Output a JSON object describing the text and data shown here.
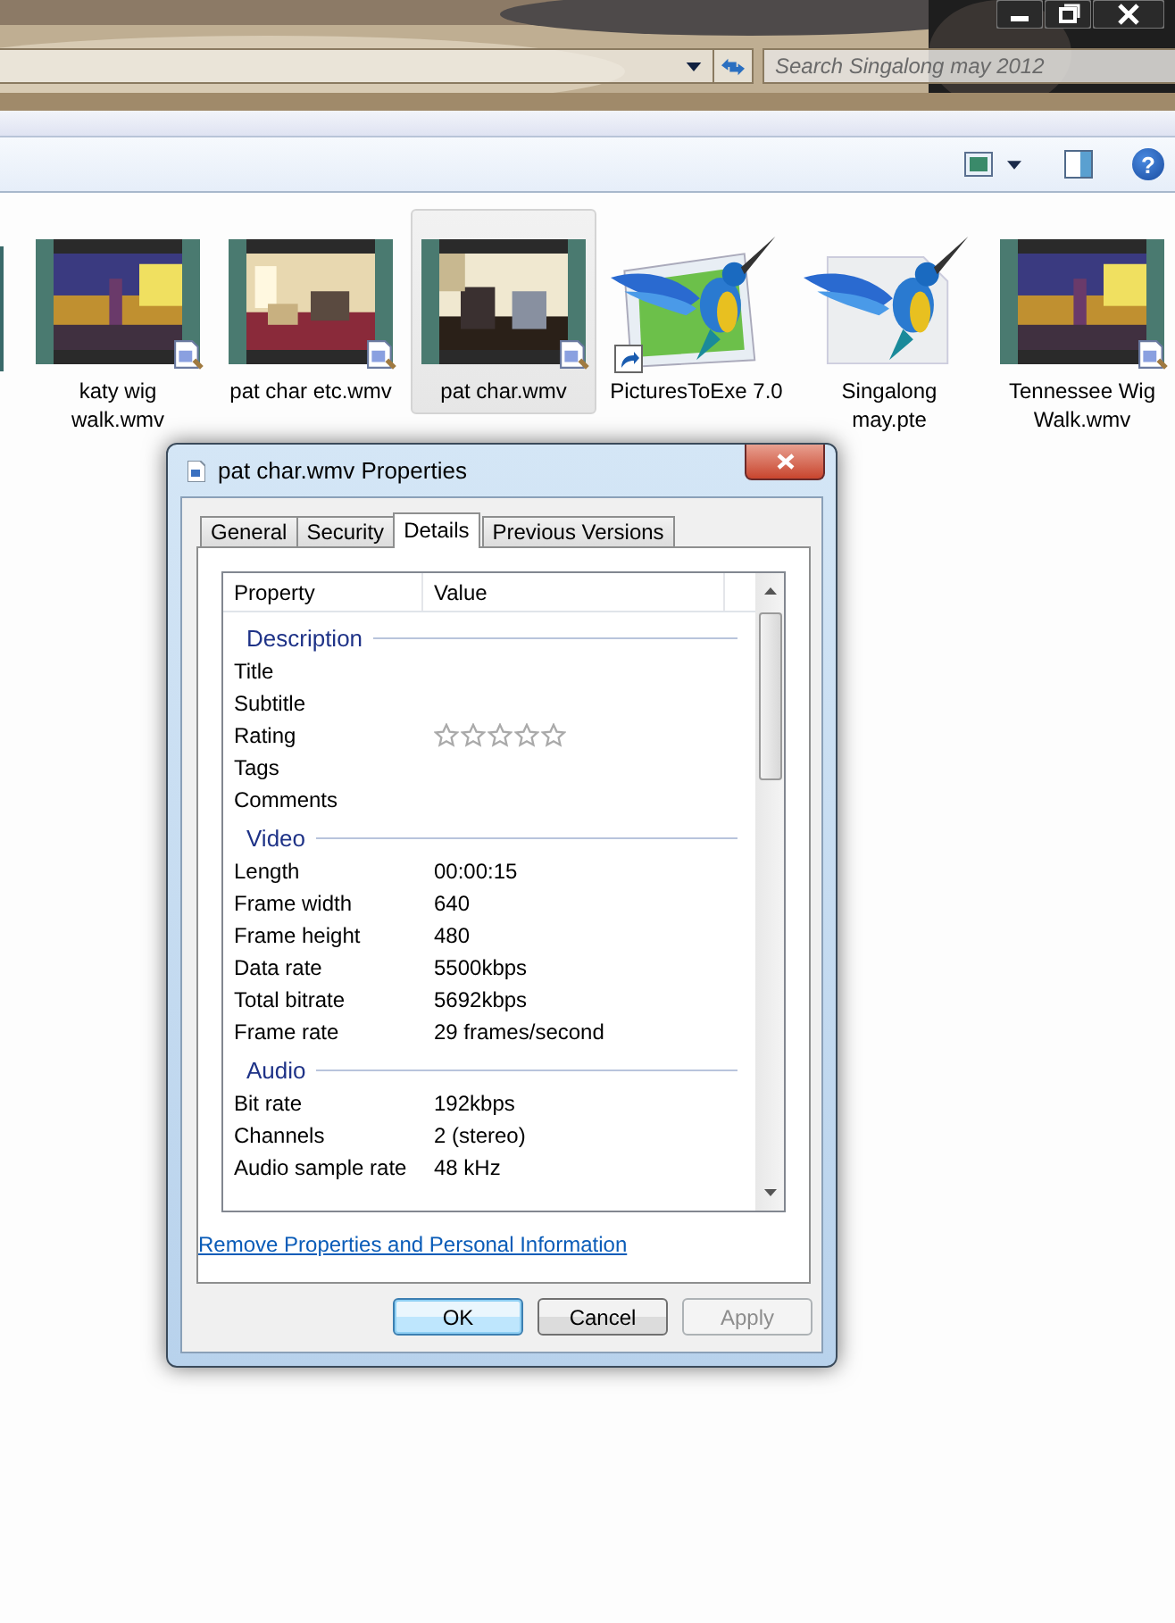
{
  "search": {
    "placeholder": "Search Singalong may 2012"
  },
  "help": "?",
  "files": [
    {
      "name": "katy wig\nwalk.wmv",
      "kind": "video",
      "selected": false
    },
    {
      "name": "pat char etc.wmv",
      "kind": "video",
      "selected": false
    },
    {
      "name": "pat char.wmv",
      "kind": "video",
      "selected": true
    },
    {
      "name": "PicturesToExe 7.0",
      "kind": "app",
      "selected": false
    },
    {
      "name": "Singalong\nmay.pte",
      "kind": "document",
      "selected": false
    },
    {
      "name": "Tennessee Wig\nWalk.wmv",
      "kind": "video",
      "selected": false
    }
  ],
  "dialog": {
    "title": "pat char.wmv Properties",
    "tabs": [
      {
        "label": "General",
        "selected": false
      },
      {
        "label": "Security",
        "selected": false
      },
      {
        "label": "Details",
        "selected": true
      },
      {
        "label": "Previous Versions",
        "selected": false
      }
    ],
    "columns": [
      "Property",
      "Value"
    ],
    "sections": [
      {
        "heading": "Description",
        "rows": [
          {
            "property": "Title",
            "kind": "text"
          },
          {
            "property": "Subtitle",
            "kind": "text"
          },
          {
            "property": "Rating",
            "kind": "rating",
            "stars": 0
          },
          {
            "property": "Tags",
            "kind": "text"
          },
          {
            "property": "Comments",
            "kind": "text"
          }
        ]
      },
      {
        "heading": "Video",
        "rows": [
          {
            "property": "Length",
            "kind": "text",
            "value": "00:00:15"
          },
          {
            "property": "Frame width",
            "kind": "text",
            "value": "640"
          },
          {
            "property": "Frame height",
            "kind": "text",
            "value": "480"
          },
          {
            "property": "Data rate",
            "kind": "text",
            "value": "5500kbps"
          },
          {
            "property": "Total bitrate",
            "kind": "text",
            "value": "5692kbps"
          },
          {
            "property": "Frame rate",
            "kind": "text",
            "value": "29 frames/second"
          }
        ]
      },
      {
        "heading": "Audio",
        "rows": [
          {
            "property": "Bit rate",
            "kind": "text",
            "value": "192kbps"
          },
          {
            "property": "Channels",
            "kind": "text",
            "value": "2 (stereo)"
          },
          {
            "property": "Audio sample rate",
            "kind": "text",
            "value": "48 kHz"
          }
        ]
      }
    ],
    "link": "Remove Properties and Personal Information",
    "buttons": [
      {
        "label": "OK",
        "default": true,
        "disabled": false
      },
      {
        "label": "Cancel",
        "default": false,
        "disabled": false
      },
      {
        "label": "Apply",
        "default": false,
        "disabled": true
      }
    ]
  }
}
